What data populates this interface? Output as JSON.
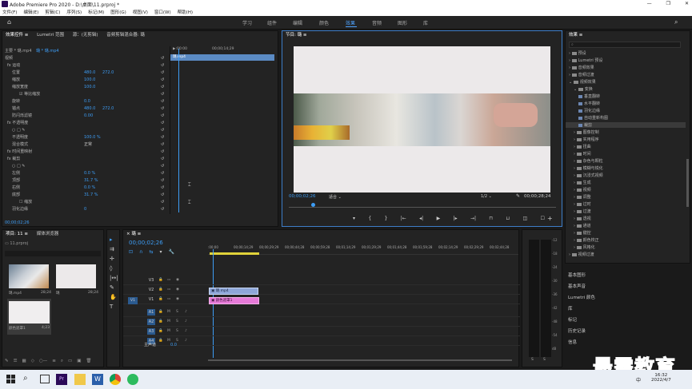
{
  "window": {
    "title": "Adobe Premiere Pro 2020 - D:\\桌面\\11.prproj *",
    "buttons": [
      "—",
      "❐",
      "✕"
    ]
  },
  "menu": [
    "文件(F)",
    "编辑(E)",
    "剪辑(C)",
    "序列(S)",
    "标记(M)",
    "图形(G)",
    "视图(V)",
    "窗口(W)",
    "帮助(H)"
  ],
  "workspaces": [
    "学习",
    "组件",
    "编辑",
    "颜色",
    "效果",
    "音频",
    "图形",
    "库"
  ],
  "effect_controls": {
    "tabs": [
      "效果控件 ≡",
      "Lumetri 范围",
      "源：(无剪辑)",
      "音频剪辑混合器: 璐"
    ],
    "source": "主要 * 璐.mp4",
    "clip": "璐 * 璐.mp4",
    "clip_label": "璐.mp4",
    "timecodes": [
      "▶:00:00",
      "00;00;14;29"
    ],
    "rows": [
      {
        "label": "视频",
        "indent": 0
      },
      {
        "label": "fx 运动",
        "indent": 1
      },
      {
        "label": "位置",
        "v1": "480.0",
        "v2": "272.0",
        "indent": 3
      },
      {
        "label": "缩放",
        "v1": "100.0",
        "indent": 3
      },
      {
        "label": "缩放宽度",
        "v1": "100.0",
        "indent": 3
      },
      {
        "label": "☑ 等比缩放",
        "indent": 6
      },
      {
        "label": "旋转",
        "v1": "0.0",
        "indent": 3
      },
      {
        "label": "锚点",
        "v1": "480.0",
        "v2": "272.0",
        "indent": 3
      },
      {
        "label": "防闪烁滤镜",
        "v1": "0.00",
        "indent": 3
      },
      {
        "label": "fx 不透明度",
        "indent": 1
      },
      {
        "label": "○ □ ✎",
        "indent": 3
      },
      {
        "label": "不透明度",
        "v1": "100.0 %",
        "indent": 3
      },
      {
        "label": "混合模式",
        "v1": "正常",
        "indent": 3
      },
      {
        "label": "fx 时间重映射",
        "indent": 1
      },
      {
        "label": "fx 裁剪",
        "indent": 1
      },
      {
        "label": "○ □ ✎",
        "indent": 3
      },
      {
        "label": "左侧",
        "v1": "0.0 %",
        "indent": 3
      },
      {
        "label": "顶部",
        "v1": "31.7 %",
        "indent": 3
      },
      {
        "label": "右侧",
        "v1": "0.0 %",
        "indent": 3
      },
      {
        "label": "底部",
        "v1": "31.7 %",
        "indent": 3
      },
      {
        "label": "☐ 缩放",
        "indent": 6
      },
      {
        "label": "羽化边缘",
        "v1": "0",
        "indent": 3
      }
    ],
    "bottom_tc": "00;00;02;26"
  },
  "program": {
    "tab": "节目: 璐 ≡",
    "timecode": "00;00;02;26",
    "fit": "适合",
    "quality": "1/2",
    "duration": "00;00;28;24"
  },
  "project": {
    "tabs": [
      "项目: 11 ≡",
      "媒体浏览器"
    ],
    "file": "11.prproj",
    "items": [
      {
        "name": "璐.mp4",
        "dur": "28;24"
      },
      {
        "name": "璐",
        "dur": "28;24"
      },
      {
        "name": "颜色遮罩1",
        "dur": "4;23"
      }
    ]
  },
  "timeline": {
    "tab": "× 璐 ≡",
    "timecode": "00;00;02;26",
    "ruler": [
      ":00;00",
      "00;00;14;29",
      "00;00;29;29",
      "00;00;44;28",
      "00;00;59;28",
      "00;01;14;29",
      "00;01;29;29",
      "00;01;44;28",
      "00;01;59;28",
      "00;02;14;29",
      "00;02;29;29",
      "00;02;44;28"
    ],
    "video_tracks": [
      "V3",
      "V2",
      "V1"
    ],
    "audio_tracks": [
      "A1",
      "A2",
      "A3",
      "A4"
    ],
    "master": "主声道",
    "master_val": "0.0",
    "clip_v2": "璐.mp4",
    "clip_v1": "颜色遮罩1"
  },
  "meter": {
    "ticks": [
      "-12",
      "-18",
      "-24",
      "-30",
      "-36",
      "-42",
      "-48",
      "-54",
      "dB"
    ],
    "labels": [
      "S",
      "S"
    ]
  },
  "effects": {
    "tab": "效果 ≡",
    "tree": [
      {
        "label": "预设",
        "indent": 0
      },
      {
        "label": "Lumetri 预设",
        "indent": 0
      },
      {
        "label": "音频效果",
        "indent": 0
      },
      {
        "label": "音频过渡",
        "indent": 0
      },
      {
        "label": "视频效果",
        "indent": 0
      },
      {
        "label": "变换",
        "indent": 1
      },
      {
        "label": "垂直翻转",
        "indent": 2
      },
      {
        "label": "水平翻转",
        "indent": 2
      },
      {
        "label": "羽化边缘",
        "indent": 2
      },
      {
        "label": "自动重新构图",
        "indent": 2
      },
      {
        "label": "裁剪",
        "indent": 2,
        "selected": true
      },
      {
        "label": "图像控制",
        "indent": 1
      },
      {
        "label": "实用程序",
        "indent": 1
      },
      {
        "label": "扭曲",
        "indent": 1
      },
      {
        "label": "时间",
        "indent": 1
      },
      {
        "label": "杂色与颗粒",
        "indent": 1
      },
      {
        "label": "模糊与锐化",
        "indent": 1
      },
      {
        "label": "沉浸式视频",
        "indent": 1
      },
      {
        "label": "生成",
        "indent": 1
      },
      {
        "label": "视频",
        "indent": 1
      },
      {
        "label": "调整",
        "indent": 1
      },
      {
        "label": "过时",
        "indent": 1
      },
      {
        "label": "过渡",
        "indent": 1
      },
      {
        "label": "透视",
        "indent": 1
      },
      {
        "label": "通道",
        "indent": 1
      },
      {
        "label": "键控",
        "indent": 1
      },
      {
        "label": "颜色校正",
        "indent": 1
      },
      {
        "label": "风格化",
        "indent": 1
      },
      {
        "label": "视频过渡",
        "indent": 0
      }
    ],
    "sections": [
      "基本图形",
      "基本声音",
      "Lumetri 颜色",
      "库",
      "标记",
      "历史记录",
      "信息"
    ]
  },
  "taskbar": {
    "search": "⌕",
    "time": "16:32",
    "date": "2022/4/7",
    "ime": "中"
  },
  "watermark": "最需教育",
  "colors": {
    "accent": "#3d9df5",
    "clip_v2": "#8ea6d8",
    "clip_v1": "#e67ad8",
    "timeline_playhead": "#3d9df5"
  }
}
